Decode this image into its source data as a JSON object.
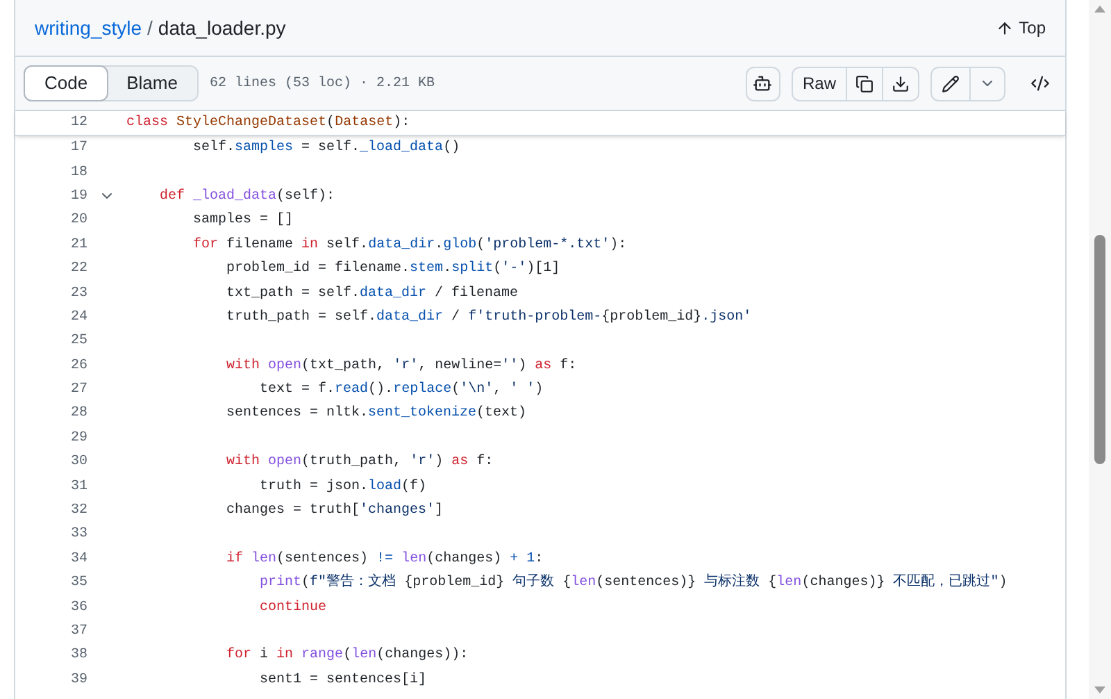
{
  "breadcrumb": {
    "repo": "writing_style",
    "separator": "/",
    "file": "data_loader.py"
  },
  "top_link": "Top",
  "tabs": [
    {
      "label": "Code",
      "selected": true
    },
    {
      "label": "Blame",
      "selected": false
    }
  ],
  "file_meta": "62 lines (53 loc) · 2.21 KB",
  "toolbar": {
    "raw": "Raw"
  },
  "sticky_line": {
    "number": "12",
    "tokens": [
      {
        "text": "class ",
        "kind": "kw"
      },
      {
        "text": "StyleChangeDataset",
        "kind": "cls"
      },
      {
        "text": "(",
        "kind": "plain"
      },
      {
        "text": "Dataset",
        "kind": "cls"
      },
      {
        "text": "):",
        "kind": "plain"
      }
    ]
  },
  "lines": [
    {
      "number": "17",
      "tokens": [
        {
          "text": "        self.",
          "kind": "plain"
        },
        {
          "text": "samples",
          "kind": "prop"
        },
        {
          "text": " = self.",
          "kind": "plain"
        },
        {
          "text": "_load_data",
          "kind": "prop"
        },
        {
          "text": "()",
          "kind": "plain"
        }
      ]
    },
    {
      "number": "18"
    },
    {
      "number": "19",
      "expanded": true,
      "tokens": [
        {
          "text": "    def ",
          "kind": "kw"
        },
        {
          "text": "_load_data",
          "kind": "fn"
        },
        {
          "text": "(self):",
          "kind": "plain"
        }
      ]
    },
    {
      "number": "20",
      "tokens": [
        {
          "text": "        samples = []",
          "kind": "plain"
        }
      ]
    },
    {
      "number": "21",
      "tokens": [
        {
          "text": "        for",
          "kind": "kw"
        },
        {
          "text": " filename ",
          "kind": "plain"
        },
        {
          "text": "in",
          "kind": "kw"
        },
        {
          "text": " self.",
          "kind": "plain"
        },
        {
          "text": "data_dir",
          "kind": "prop"
        },
        {
          "text": ".",
          "kind": "plain"
        },
        {
          "text": "glob",
          "kind": "prop"
        },
        {
          "text": "(",
          "kind": "plain"
        },
        {
          "text": "'problem-*.txt'",
          "kind": "str"
        },
        {
          "text": "):",
          "kind": "plain"
        }
      ]
    },
    {
      "number": "22",
      "tokens": [
        {
          "text": "            problem_id = filename.",
          "kind": "plain"
        },
        {
          "text": "stem",
          "kind": "prop"
        },
        {
          "text": ".",
          "kind": "plain"
        },
        {
          "text": "split",
          "kind": "prop"
        },
        {
          "text": "(",
          "kind": "plain"
        },
        {
          "text": "'-'",
          "kind": "str"
        },
        {
          "text": ")[1]",
          "kind": "plain"
        }
      ]
    },
    {
      "number": "23",
      "tokens": [
        {
          "text": "            txt_path = self.",
          "kind": "plain"
        },
        {
          "text": "data_dir",
          "kind": "prop"
        },
        {
          "text": " / filename",
          "kind": "plain"
        }
      ]
    },
    {
      "number": "24",
      "tokens": [
        {
          "text": "            truth_path = self.",
          "kind": "plain"
        },
        {
          "text": "data_dir",
          "kind": "prop"
        },
        {
          "text": " / ",
          "kind": "plain"
        },
        {
          "text": "f'truth-problem-",
          "kind": "str"
        },
        {
          "text": "{problem_id}",
          "kind": "plain"
        },
        {
          "text": ".json'",
          "kind": "str"
        }
      ]
    },
    {
      "number": "25"
    },
    {
      "number": "26",
      "tokens": [
        {
          "text": "            with ",
          "kind": "kw"
        },
        {
          "text": "open",
          "kind": "fn"
        },
        {
          "text": "(txt_path, ",
          "kind": "plain"
        },
        {
          "text": "'r'",
          "kind": "str"
        },
        {
          "text": ", newline=",
          "kind": "plain"
        },
        {
          "text": "''",
          "kind": "str"
        },
        {
          "text": ") ",
          "kind": "plain"
        },
        {
          "text": "as",
          "kind": "kw"
        },
        {
          "text": " f:",
          "kind": "plain"
        }
      ]
    },
    {
      "number": "27",
      "tokens": [
        {
          "text": "                text = f.",
          "kind": "plain"
        },
        {
          "text": "read",
          "kind": "prop"
        },
        {
          "text": "().",
          "kind": "plain"
        },
        {
          "text": "replace",
          "kind": "prop"
        },
        {
          "text": "(",
          "kind": "plain"
        },
        {
          "text": "'\\n'",
          "kind": "str"
        },
        {
          "text": ", ",
          "kind": "plain"
        },
        {
          "text": "' '",
          "kind": "str"
        },
        {
          "text": ")",
          "kind": "plain"
        }
      ]
    },
    {
      "number": "28",
      "tokens": [
        {
          "text": "            sentences = nltk.",
          "kind": "plain"
        },
        {
          "text": "sent_tokenize",
          "kind": "prop"
        },
        {
          "text": "(text)",
          "kind": "plain"
        }
      ]
    },
    {
      "number": "29"
    },
    {
      "number": "30",
      "tokens": [
        {
          "text": "            with ",
          "kind": "kw"
        },
        {
          "text": "open",
          "kind": "fn"
        },
        {
          "text": "(truth_path, ",
          "kind": "plain"
        },
        {
          "text": "'r'",
          "kind": "str"
        },
        {
          "text": ") ",
          "kind": "plain"
        },
        {
          "text": "as",
          "kind": "kw"
        },
        {
          "text": " f:",
          "kind": "plain"
        }
      ]
    },
    {
      "number": "31",
      "tokens": [
        {
          "text": "                truth = json.",
          "kind": "plain"
        },
        {
          "text": "load",
          "kind": "prop"
        },
        {
          "text": "(f)",
          "kind": "plain"
        }
      ]
    },
    {
      "number": "32",
      "tokens": [
        {
          "text": "            changes = truth[",
          "kind": "plain"
        },
        {
          "text": "'changes'",
          "kind": "str"
        },
        {
          "text": "]",
          "kind": "plain"
        }
      ]
    },
    {
      "number": "33"
    },
    {
      "number": "34",
      "tokens": [
        {
          "text": "            if ",
          "kind": "kw"
        },
        {
          "text": "len",
          "kind": "fn"
        },
        {
          "text": "(sentences) ",
          "kind": "plain"
        },
        {
          "text": "!= ",
          "kind": "prop"
        },
        {
          "text": "len",
          "kind": "fn"
        },
        {
          "text": "(changes) ",
          "kind": "plain"
        },
        {
          "text": "+ 1",
          "kind": "prop"
        },
        {
          "text": ":",
          "kind": "plain"
        }
      ]
    },
    {
      "number": "35",
      "tokens": [
        {
          "text": "                print",
          "kind": "fn"
        },
        {
          "text": "(",
          "kind": "plain"
        },
        {
          "text": "f\"警告：文档 ",
          "kind": "str"
        },
        {
          "text": "{problem_id}",
          "kind": "plain"
        },
        {
          "text": " 句子数 ",
          "kind": "str"
        },
        {
          "text": "{",
          "kind": "plain"
        },
        {
          "text": "len",
          "kind": "fn"
        },
        {
          "text": "(sentences)}",
          "kind": "plain"
        },
        {
          "text": " 与标注数 ",
          "kind": "str"
        },
        {
          "text": "{",
          "kind": "plain"
        },
        {
          "text": "len",
          "kind": "fn"
        },
        {
          "text": "(changes)}",
          "kind": "plain"
        },
        {
          "text": " 不匹配，已跳过\"",
          "kind": "str"
        },
        {
          "text": ")",
          "kind": "plain"
        }
      ]
    },
    {
      "number": "36",
      "tokens": [
        {
          "text": "                continue",
          "kind": "kw"
        }
      ]
    },
    {
      "number": "37"
    },
    {
      "number": "38",
      "tokens": [
        {
          "text": "            for",
          "kind": "kw"
        },
        {
          "text": " i ",
          "kind": "plain"
        },
        {
          "text": "in ",
          "kind": "kw"
        },
        {
          "text": "range",
          "kind": "fn"
        },
        {
          "text": "(",
          "kind": "plain"
        },
        {
          "text": "len",
          "kind": "fn"
        },
        {
          "text": "(changes)):",
          "kind": "plain"
        }
      ]
    },
    {
      "number": "39",
      "tokens": [
        {
          "text": "                sent1 = sentences[i]",
          "kind": "plain"
        }
      ]
    }
  ]
}
